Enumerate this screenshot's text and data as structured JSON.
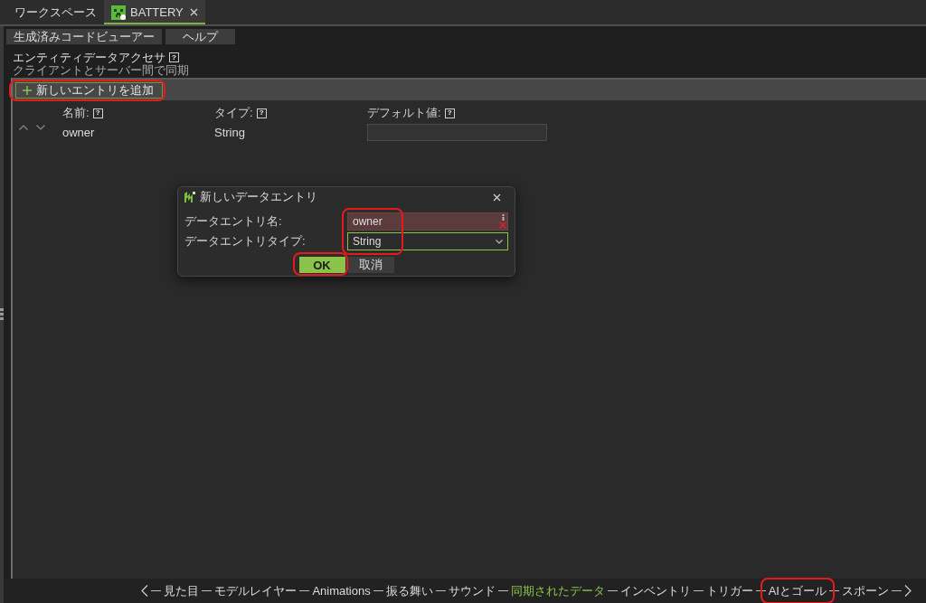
{
  "tabs": [
    {
      "label": "ワークスペース",
      "kind": "workspace",
      "selected": false,
      "closable": false
    },
    {
      "label": "BATTERY",
      "kind": "entity",
      "selected": true,
      "closable": true
    }
  ],
  "toolbar": {
    "buttons": [
      "生成済みコードビューアー",
      "ヘルプ"
    ]
  },
  "section": {
    "title": "エンティティデータアクセサ",
    "help": "?",
    "subtitle": "クライアントとサーバー間で同期"
  },
  "panel": {
    "add_button": {
      "label": "新しいエントリを追加",
      "highlighted": true
    },
    "columns": [
      {
        "label": "名前:",
        "help": "?"
      },
      {
        "label": "タイプ:",
        "help": "?"
      },
      {
        "label": "デフォルト値:",
        "help": "?"
      }
    ],
    "rows": [
      {
        "name": "owner",
        "type": "String"
      }
    ]
  },
  "dialog": {
    "title": "新しいデータエントリ",
    "fields_highlighted": true,
    "fields": [
      {
        "label": "データエントリ名:",
        "kind": "text",
        "value": "owner",
        "invalid": true,
        "focused": false
      },
      {
        "label": "データエントリタイプ:",
        "kind": "select",
        "value": "String",
        "invalid": false,
        "focused": true
      }
    ],
    "buttons": [
      {
        "label": "OK",
        "kind": "primary",
        "highlighted": true
      },
      {
        "label": "取消",
        "kind": "secondary",
        "highlighted": false
      }
    ]
  },
  "nav": {
    "items": [
      {
        "label": "見た目",
        "selected": false,
        "highlighted": false
      },
      {
        "label": "モデルレイヤー",
        "selected": false,
        "highlighted": false
      },
      {
        "label": "Animations",
        "selected": false,
        "highlighted": false
      },
      {
        "label": "振る舞い",
        "selected": false,
        "highlighted": false
      },
      {
        "label": "サウンド",
        "selected": false,
        "highlighted": false
      },
      {
        "label": "同期されたデータ",
        "selected": true,
        "highlighted": false
      },
      {
        "label": "インベントリ",
        "selected": false,
        "highlighted": false
      },
      {
        "label": "トリガー",
        "selected": false,
        "highlighted": false
      },
      {
        "label": "AIとゴール",
        "selected": false,
        "highlighted": true
      },
      {
        "label": "スポーン",
        "selected": false,
        "highlighted": false
      }
    ]
  }
}
